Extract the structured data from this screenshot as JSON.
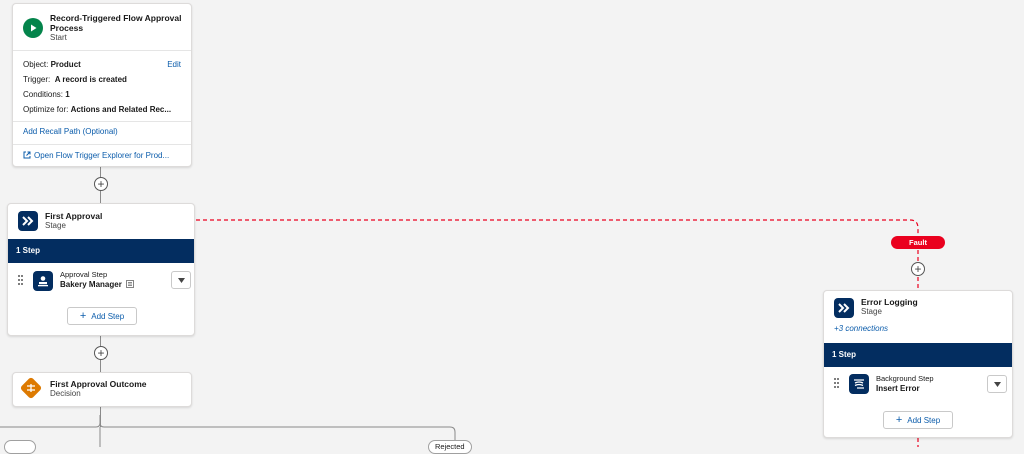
{
  "start": {
    "title": "Record-Triggered Flow Approval Process",
    "subtitle": "Start",
    "edit_label": "Edit",
    "object_label": "Object:",
    "object_value": "Product",
    "trigger_label": "Trigger:",
    "trigger_value": "A record is created",
    "conditions_label": "Conditions:",
    "conditions_value": "1",
    "optimize_label": "Optimize for:",
    "optimize_value": "Actions and Related Rec...",
    "recall_link": "Add Recall Path (Optional)",
    "explorer_link": "Open Flow Trigger Explorer for Prod..."
  },
  "first_approval": {
    "title": "First Approval",
    "subtitle": "Stage",
    "step_count": "1 Step",
    "step_type": "Approval Step",
    "step_name": "Bakery Manager",
    "add_step_label": "Add Step"
  },
  "decision": {
    "title": "First Approval Outcome",
    "subtitle": "Decision"
  },
  "branch": {
    "rejected_label": "Rejected"
  },
  "fault": {
    "label": "Fault"
  },
  "error_logging": {
    "title": "Error Logging",
    "subtitle": "Stage",
    "connections": "+3 connections",
    "step_count": "1 Step",
    "step_type": "Background Step",
    "step_name": "Insert Error",
    "add_step_label": "Add Step"
  },
  "colors": {
    "navy": "#032d60",
    "start_green": "#04844b",
    "decision_orange": "#dd7a01",
    "fault_red": "#ea001e",
    "link_blue": "#0b5cab"
  }
}
